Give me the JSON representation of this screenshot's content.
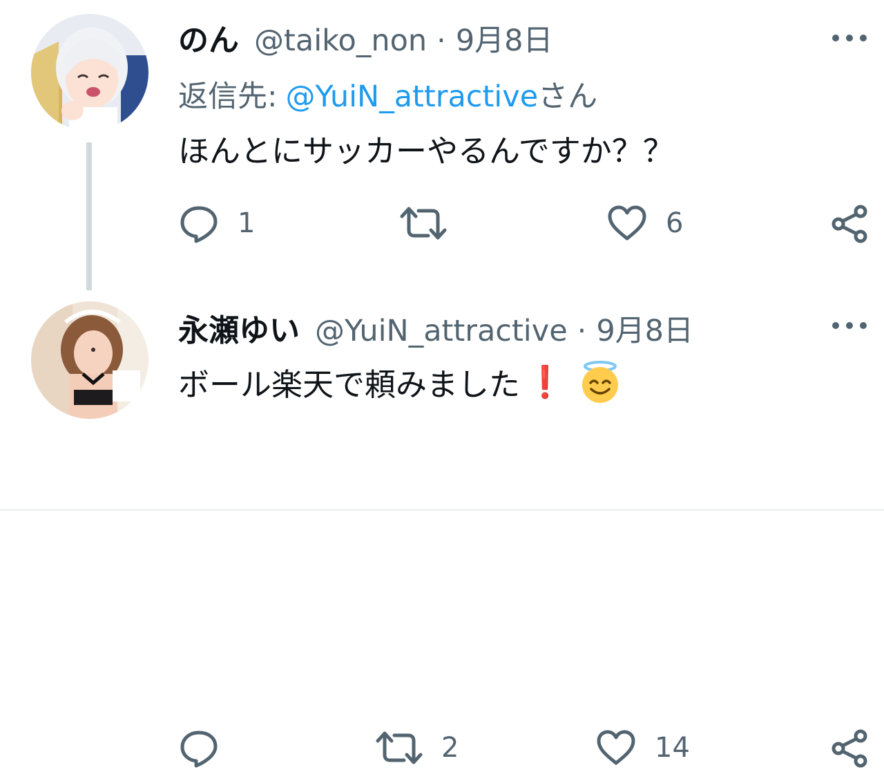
{
  "tweets": [
    {
      "display_name": "のん",
      "handle": "@taiko_non",
      "separator": "·",
      "time": "9月8日",
      "reply_prefix": "返信先:",
      "reply_mention": "@YuiN_attractive",
      "reply_suffix": "さん",
      "text": "ほんとにサッカーやるんですか？？",
      "actions": {
        "reply_count": "1",
        "retweet_count": "",
        "like_count": "6"
      },
      "avatar_icon": "anime-girl-avatar"
    },
    {
      "display_name": "永瀬ゆい",
      "handle": "@YuiN_attractive",
      "separator": "·",
      "time": "9月8日",
      "text": "ボール楽天で頼みました",
      "exclaim": "❗",
      "emoji": "smiling-face-with-halo",
      "actions": {
        "reply_count": "",
        "retweet_count": "2",
        "like_count": "14"
      },
      "avatar_icon": "user-photo-avatar"
    }
  ],
  "colors": {
    "secondary_text": "#536471",
    "link": "#1d9bf0",
    "thread_line": "#cfd9de"
  }
}
